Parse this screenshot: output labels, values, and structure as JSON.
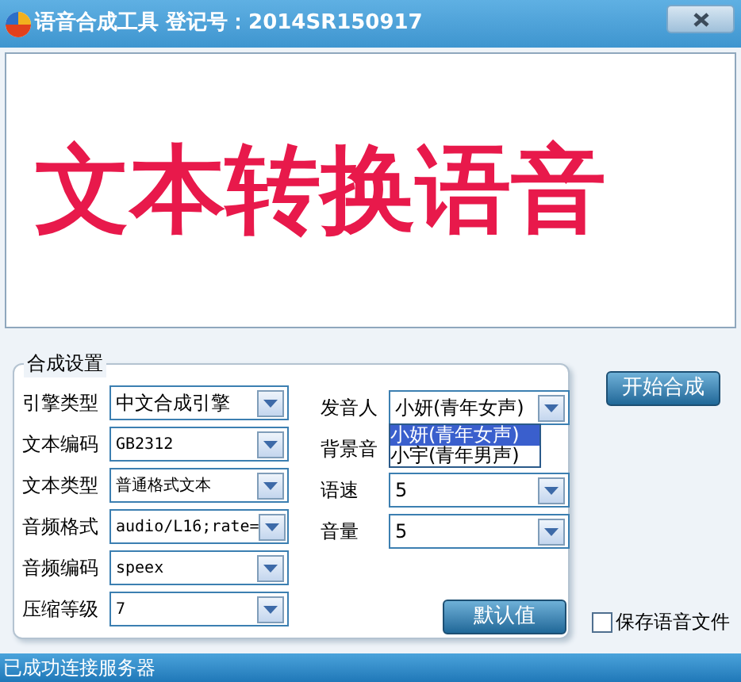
{
  "window": {
    "title": "语音合成工具 登记号：2014SR150917"
  },
  "text_area": {
    "value": "文本转换语音"
  },
  "settings": {
    "title": "合成设置",
    "left_fields": [
      {
        "label": "引擎类型",
        "value": "中文合成引擎"
      },
      {
        "label": "文本编码",
        "value": "GB2312"
      },
      {
        "label": "文本类型",
        "value": "普通格式文本"
      },
      {
        "label": "音频格式",
        "value": "audio/L16;rate="
      },
      {
        "label": "音频编码",
        "value": "speex"
      },
      {
        "label": "压缩等级",
        "value": "7"
      }
    ],
    "right_fields": [
      {
        "kind": "open",
        "label": "发音人",
        "value": "小妍(青年女声)",
        "options": [
          {
            "label": "小妍(青年女声)",
            "selected": true
          },
          {
            "label": "小宇(青年男声)",
            "selected": false
          }
        ]
      },
      {
        "kind": "hidden",
        "label": "背景音"
      },
      {
        "kind": "combo",
        "label": "语速",
        "value": "5"
      },
      {
        "kind": "combo",
        "label": "音量",
        "value": "5"
      }
    ],
    "default_button": "默认值"
  },
  "start_button": "开始合成",
  "save_checkbox": {
    "label": "保存语音文件",
    "checked": false
  },
  "status_bar": "已成功连接服务器"
}
